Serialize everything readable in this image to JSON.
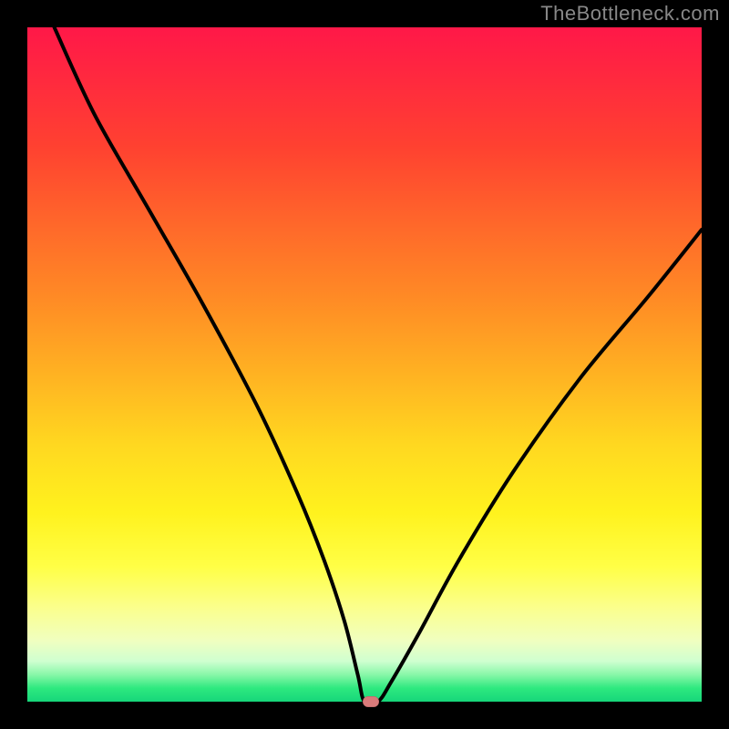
{
  "watermark": "TheBottleneck.com",
  "colors": {
    "background": "#000000",
    "curve": "#000000",
    "marker": "#d97a7a",
    "gradient_stops": [
      "#ff1848",
      "#ff2a3e",
      "#ff4230",
      "#ff6a2a",
      "#ff8a25",
      "#ffb422",
      "#ffd820",
      "#fff21e",
      "#ffff46",
      "#fbff8c",
      "#f0ffc0",
      "#cfffd0",
      "#88f7a8",
      "#2ee97f",
      "#16d67a"
    ]
  },
  "chart_data": {
    "type": "line",
    "title": "",
    "xlabel": "",
    "ylabel": "",
    "xlim": [
      0,
      100
    ],
    "ylim": [
      0,
      100
    ],
    "legend": false,
    "grid": false,
    "series": [
      {
        "name": "bottleneck-curve",
        "x": [
          4,
          10,
          18,
          26,
          34,
          40,
          44,
          47,
          49,
          50,
          52,
          54,
          58,
          64,
          72,
          82,
          92,
          100
        ],
        "y": [
          100,
          87,
          73,
          59,
          44,
          31,
          21,
          12,
          4,
          0,
          0,
          3,
          10,
          21,
          34,
          48,
          60,
          70
        ]
      }
    ],
    "marker": {
      "x": 51,
      "y": 0,
      "name": "optimum-point"
    },
    "background_gradient": {
      "direction": "vertical",
      "from": "#ff1848",
      "to": "#16d67a",
      "meaning": "top = high bottleneck (bad/red), bottom = low bottleneck (good/green)"
    }
  }
}
